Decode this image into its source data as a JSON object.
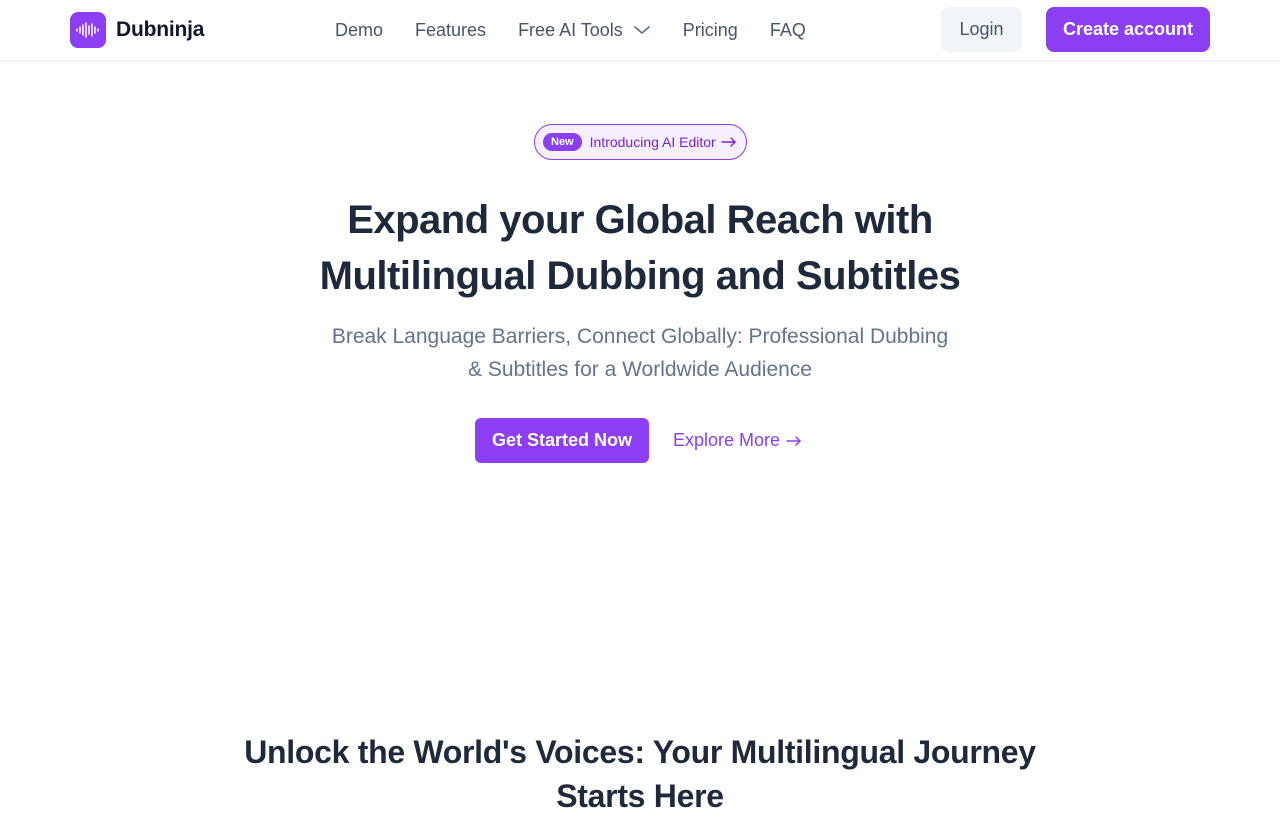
{
  "header": {
    "logo_text": "Dubninja",
    "nav": {
      "demo": "Demo",
      "features": "Features",
      "free_ai_tools": "Free AI Tools",
      "pricing": "Pricing",
      "faq": "FAQ"
    },
    "login_label": "Login",
    "create_account_label": "Create account"
  },
  "hero": {
    "badge_label": "New",
    "announcement": "Introducing AI Editor",
    "title_line1": "Expand your Global Reach with",
    "title_line2": "Multilingual Dubbing and Subtitles",
    "subtitle_line1": "Break Language Barriers, Connect Globally: Professional Dubbing",
    "subtitle_line2": "& Subtitles for a Worldwide Audience",
    "primary_cta": "Get Started Now",
    "secondary_cta": "Explore More"
  },
  "section": {
    "title_line1": "Unlock the World's Voices: Your Multilingual Journey",
    "title_line2": "Starts Here"
  },
  "icons": {
    "logo": "sound-wave-icon",
    "dropdown": "chevron-down-icon",
    "arrow": "arrow-right-icon"
  },
  "colors": {
    "brand": "#8b3ef2",
    "text_dark": "#1e293b",
    "text_muted": "#64748b",
    "nav_text": "#475569"
  }
}
